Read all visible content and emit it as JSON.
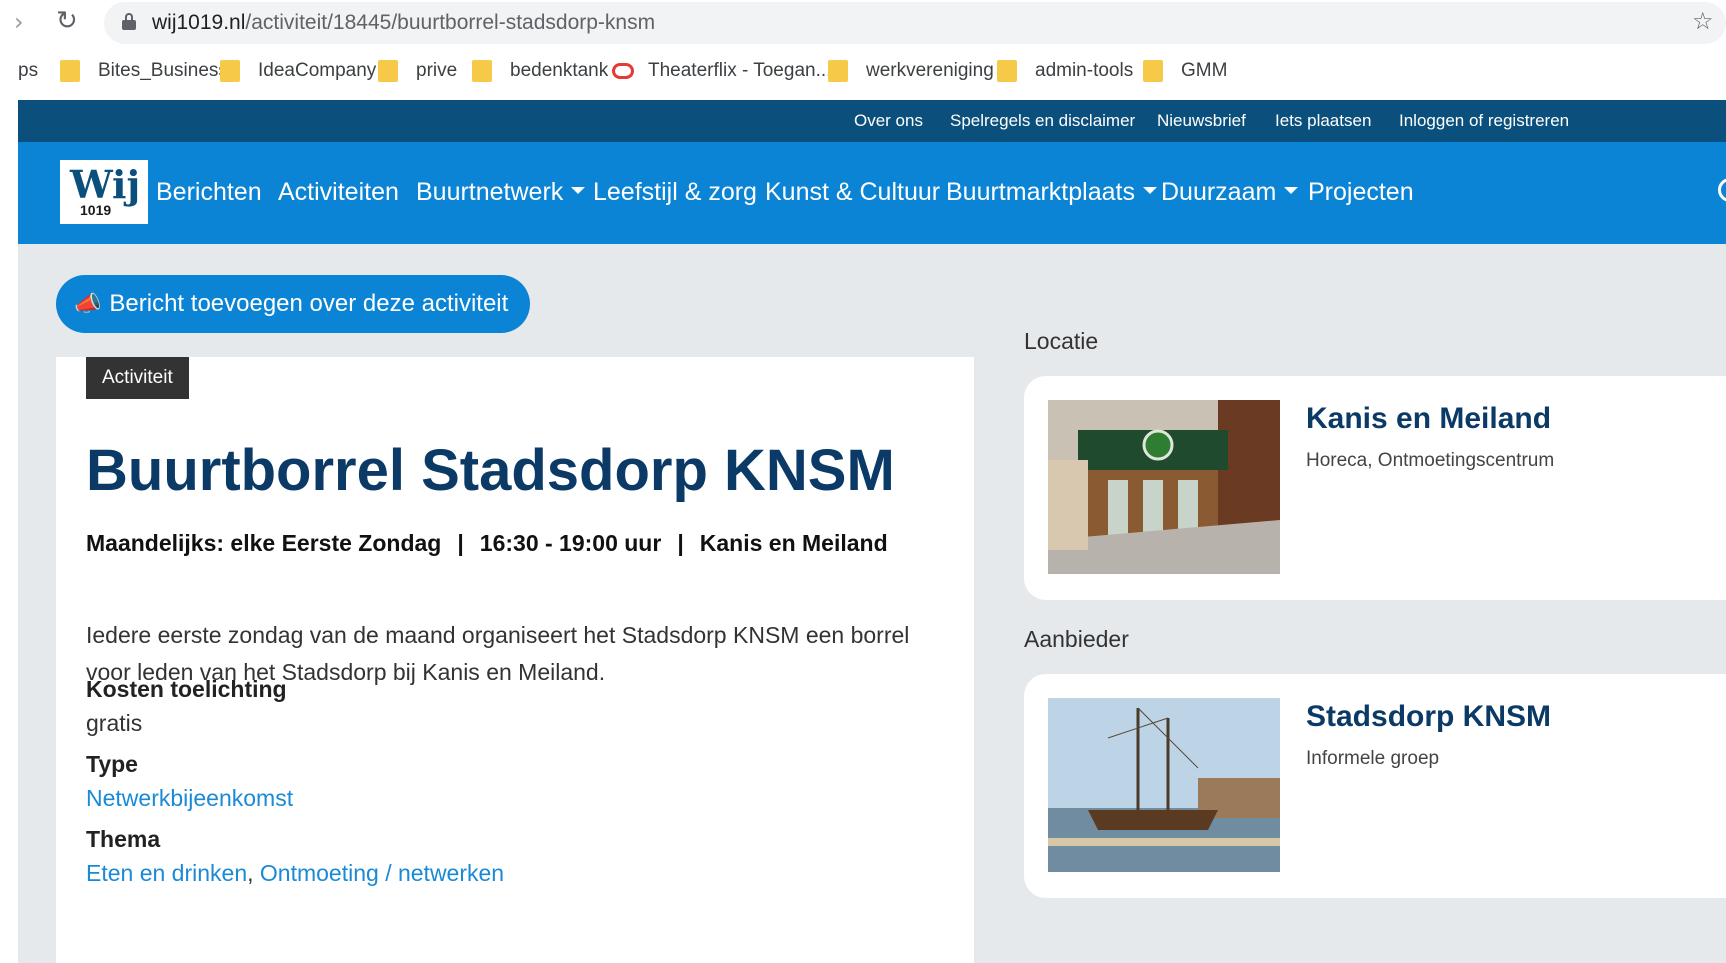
{
  "browser": {
    "url_host": "wij1019.nl",
    "url_path": "/activiteit/18445/buurtborrel-stadsdorp-knsm",
    "bookmarks": [
      "ps",
      "Bites_Business",
      "IdeaCompany",
      "prive",
      "bedenktank",
      "Theaterflix - Toegan...",
      "werkvereniging",
      "admin-tools",
      "GMM"
    ]
  },
  "topbar": {
    "links": [
      "Over ons",
      "Spelregels en disclaimer",
      "Nieuwsbrief",
      "Iets plaatsen",
      "Inloggen of registreren"
    ]
  },
  "logo": {
    "word": "Wij",
    "number": "1019"
  },
  "nav": {
    "items": [
      "Berichten",
      "Activiteiten",
      "Buurtnetwerk",
      "Leefstijl & zorg",
      "Kunst & Cultuur",
      "Buurtmarktplaats",
      "Duurzaam",
      "Projecten"
    ]
  },
  "add_post_button": "Bericht toevoegen over deze activiteit",
  "activity": {
    "badge": "Activiteit",
    "title": "Buurtborrel Stadsdorp KNSM",
    "frequency": "Maandelijks: elke Eerste Zondag",
    "separator": "|",
    "time": "16:30 - 19:00 uur",
    "location": "Kanis en Meiland",
    "description": "Iedere eerste zondag van de maand organiseert het Stadsdorp KNSM een borrel voor leden van het Stadsdorp bij Kanis en Meiland.",
    "costs_label": "Kosten toelichting",
    "costs_value": "gratis",
    "type_label": "Type",
    "type_value": "Netwerkbijeenkomst",
    "theme_label": "Thema",
    "theme_values": [
      "Eten en drinken",
      "Ontmoeting / netwerken"
    ],
    "theme_separator": ","
  },
  "sidebar": {
    "location_heading": "Locatie",
    "location_name": "Kanis en Meiland",
    "location_tags": "Horeca, Ontmoetingscentrum",
    "provider_heading": "Aanbieder",
    "provider_name": "Stadsdorp KNSM",
    "provider_tags": "Informele groep"
  },
  "colors": {
    "topbar": "#0b4f7c",
    "nav": "#0b84d6",
    "title": "#0b3a66",
    "link": "#1a8ad6",
    "page_bg": "#e6e9ec"
  }
}
